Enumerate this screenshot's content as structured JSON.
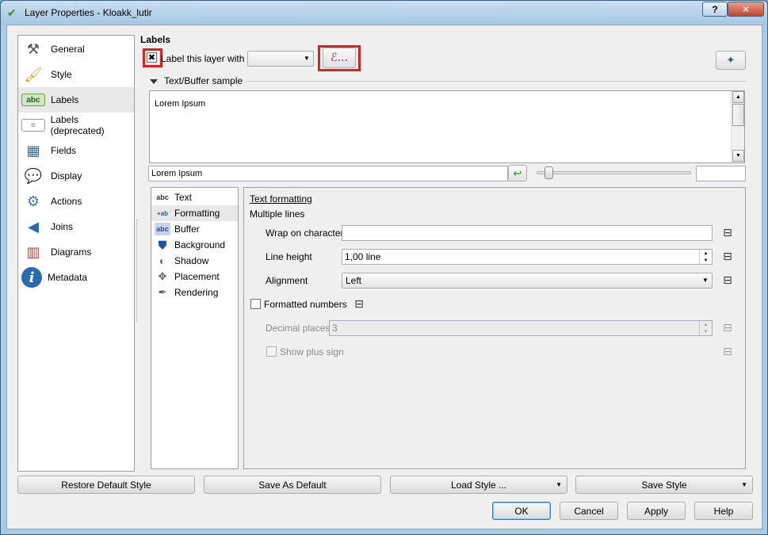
{
  "window": {
    "title": "Layer Properties - Kloakk_lutir",
    "help_label": "?",
    "close_label": "✕"
  },
  "sidebar": {
    "items": [
      {
        "label": "General",
        "icon": "wrench-icon"
      },
      {
        "label": "Style",
        "icon": "brush-icon"
      },
      {
        "label": "Labels",
        "icon": "abc-label-icon"
      },
      {
        "label": "Labels (deprecated)",
        "icon": "label-tag-icon"
      },
      {
        "label": "Fields",
        "icon": "table-icon"
      },
      {
        "label": "Display",
        "icon": "speech-bubble-icon"
      },
      {
        "label": "Actions",
        "icon": "gear-play-icon"
      },
      {
        "label": "Joins",
        "icon": "join-arrow-icon"
      },
      {
        "label": "Diagrams",
        "icon": "chart-icon"
      },
      {
        "label": "Metadata",
        "icon": "info-icon"
      }
    ],
    "active": "Labels"
  },
  "labels": {
    "heading": "Labels",
    "label_layer_with": "Label this layer with",
    "label_layer_checked": true,
    "field_combo_value": "",
    "expression_button": "ℰ...",
    "sample_group": "Text/Buffer sample",
    "sample_text": "Lorem Ipsum",
    "sample_input": "Lorem Ipsum",
    "scale_input": "",
    "slider_value": 0.05
  },
  "sections": {
    "items": [
      {
        "label": "Text",
        "icon": "abc-text-icon"
      },
      {
        "label": "Formatting",
        "icon": "formatting-icon"
      },
      {
        "label": "Buffer",
        "icon": "abc-buffer-icon"
      },
      {
        "label": "Background",
        "icon": "shield-icon"
      },
      {
        "label": "Shadow",
        "icon": "shadow-icon"
      },
      {
        "label": "Placement",
        "icon": "placement-icon"
      },
      {
        "label": "Rendering",
        "icon": "pen-icon"
      }
    ],
    "active": "Formatting"
  },
  "formatting": {
    "title": "Text formatting",
    "multiple_lines": "Multiple lines",
    "wrap_label": "Wrap on character",
    "wrap_value": "",
    "line_height_label": "Line height",
    "line_height_value": "1,00 line",
    "alignment_label": "Alignment",
    "alignment_value": "Left",
    "formatted_numbers_label": "Formatted numbers",
    "formatted_numbers_checked": false,
    "decimal_places_label": "Decimal places",
    "decimal_places_value": "3",
    "show_plus_sign_label": "Show plus sign",
    "show_plus_sign_checked": false
  },
  "footer": {
    "restore": "Restore Default Style",
    "save_default": "Save As Default",
    "load_style": "Load Style ...",
    "save_style": "Save Style",
    "ok": "OK",
    "cancel": "Cancel",
    "apply": "Apply",
    "help": "Help"
  }
}
